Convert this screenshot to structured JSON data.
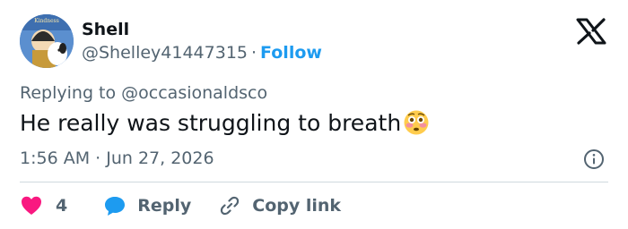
{
  "author": {
    "name": "Shell",
    "handle": "@Shelley41447315",
    "separator": "·",
    "follow_label": "Follow"
  },
  "reply_to": "Replying to @occasionaldsco",
  "text": "He really was struggling to breath",
  "emoji": "flushed-face",
  "timestamp": "1:56 AM · Jun 27, 2026",
  "actions": {
    "like_count": "4",
    "reply_label": "Reply",
    "copy_label": "Copy link"
  },
  "colors": {
    "link": "#1d9bf0",
    "like": "#f91880",
    "reply": "#1d9bf0",
    "secondary_text": "#536471",
    "primary_text": "#0f1419"
  },
  "icons": [
    "x-logo-icon",
    "info-icon",
    "heart-icon",
    "reply-bubble-icon",
    "link-icon"
  ]
}
